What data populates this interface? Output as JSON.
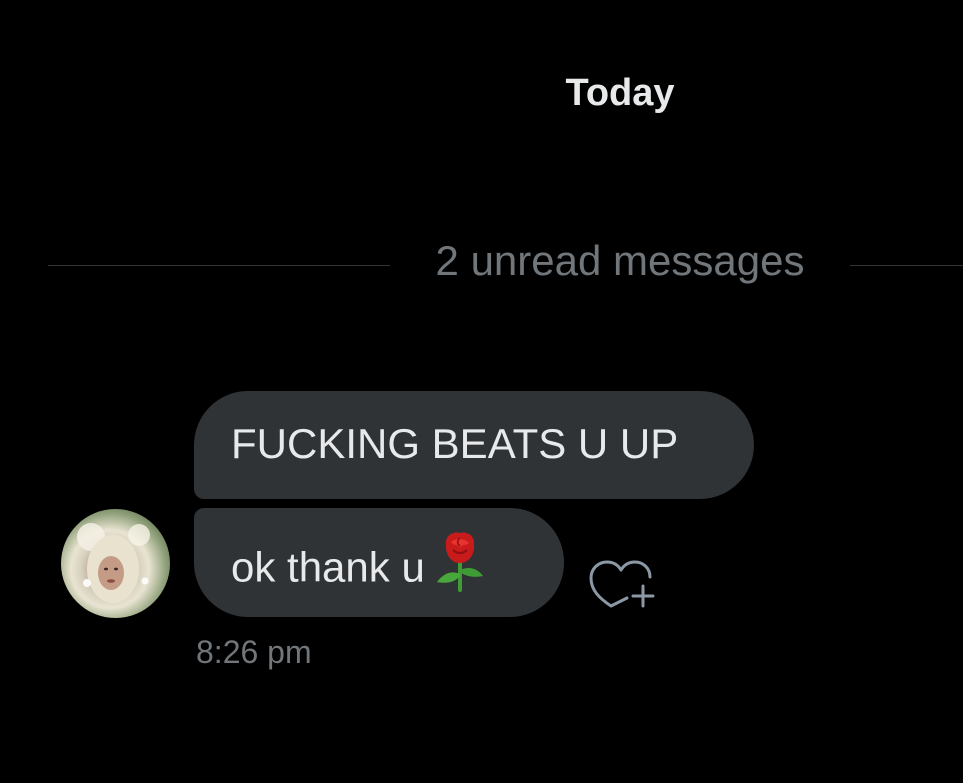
{
  "conversation": {
    "date_header": "Today",
    "unread_divider": "2 unread messages",
    "messages": [
      {
        "text": "FUCKING BEATS U UP"
      },
      {
        "text": "ok thank u",
        "emoji_icon": "rose-icon"
      }
    ],
    "timestamp": "8:26 pm",
    "reaction_icon": "heart-plus-icon"
  },
  "colors": {
    "background": "#000000",
    "bubble": "#2f3336",
    "text_primary": "#e7e9ea",
    "text_secondary": "#71767b",
    "divider": "#333639"
  }
}
